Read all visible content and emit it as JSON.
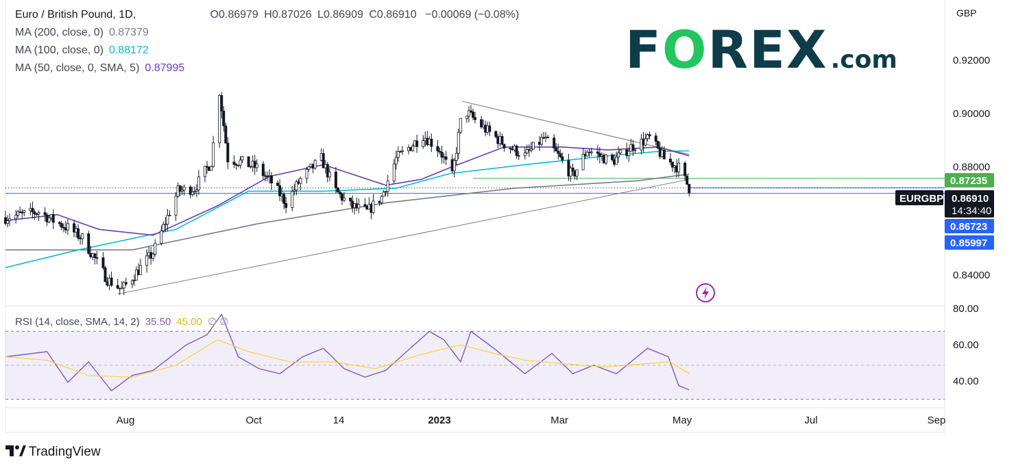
{
  "header": {
    "symbol": "Euro / British Pound, 1D,",
    "open": "O0.86979",
    "high": "H0.87026",
    "low": "L0.86909",
    "close": "C0.86910",
    "change": "−0.00069 (−0.08%)"
  },
  "indicators": {
    "ma200": {
      "label": "MA (200, close, 0)",
      "value": "0.87379",
      "color": "#787b86"
    },
    "ma100": {
      "label": "MA (100, close, 0)",
      "value": "0.88172",
      "color": "#00bcd4"
    },
    "ma50": {
      "label": "MA (50, close, 0, SMA, 5)",
      "value": "0.87995",
      "color": "#673ab7"
    },
    "rsi": {
      "label": "RSI (14, close, SMA, 14, 2)",
      "value": "35.50",
      "ma_value": "45.00",
      "extra": "∅  ∅",
      "color": "#7e57c2",
      "ma_color": "#f7d33b"
    }
  },
  "logo": {
    "text": "FOREX",
    "suffix": ".com",
    "color": "#0e3c4a",
    "accent": "#22c55e"
  },
  "footer": {
    "brand": "TradingView"
  },
  "price_axis": {
    "currency": "GBP",
    "ticks": [
      "0.92000",
      "0.90000",
      "0.88000",
      "0.84000"
    ],
    "labels": {
      "green_level": "0.87235",
      "symbol_tag": "EURGBP",
      "last_price": "0.86910",
      "countdown": "14:34:40",
      "blue_level_1": "0.86723",
      "blue_level_2": "0.85997"
    }
  },
  "rsi_axis": {
    "ticks": [
      "80.00",
      "60.00",
      "40.00"
    ]
  },
  "time_axis": {
    "labels": [
      "Aug",
      "Oct",
      "14",
      "2023",
      "Mar",
      "May",
      "Jul",
      "Sep"
    ]
  },
  "chart_data": [
    {
      "type": "candlestick",
      "title": "Euro / British Pound, 1D",
      "ylabel": "GBP",
      "ylim": [
        0.829,
        0.933
      ],
      "x_range": [
        "2022-06-15",
        "2023-09-10"
      ],
      "hlines": [
        {
          "value": 0.87235,
          "color": "#4caf50"
        },
        {
          "value": 0.86723,
          "color": "#2962ff"
        },
        {
          "value": 0.8691,
          "color": "#2962ff"
        }
      ],
      "trendlines": [
        {
          "from": [
            "2022-08-08",
            0.833
          ],
          "to": [
            "2023-05-10",
            0.872
          ]
        },
        {
          "from": [
            "2023-01-21",
            0.8985
          ],
          "to": [
            "2023-05-10",
            0.8805
          ]
        }
      ],
      "key_points": [
        {
          "date": "2022-06-15",
          "close": 0.859
        },
        {
          "date": "2022-07-01",
          "close": 0.861
        },
        {
          "date": "2022-07-08",
          "close": 0.858
        },
        {
          "date": "2022-07-15",
          "close": 0.8555
        },
        {
          "date": "2022-07-22",
          "close": 0.852
        },
        {
          "date": "2022-08-03",
          "close": 0.838
        },
        {
          "date": "2022-08-10",
          "close": 0.8345
        },
        {
          "date": "2022-08-25",
          "close": 0.847
        },
        {
          "date": "2022-09-06",
          "close": 0.868
        },
        {
          "date": "2022-09-14",
          "close": 0.869
        },
        {
          "date": "2022-09-22",
          "close": 0.878
        },
        {
          "date": "2022-09-26",
          "close": 0.902
        },
        {
          "date": "2022-09-30",
          "close": 0.879
        },
        {
          "date": "2022-10-06",
          "close": 0.878
        },
        {
          "date": "2022-10-14",
          "close": 0.876
        },
        {
          "date": "2022-10-21",
          "close": 0.871
        },
        {
          "date": "2022-10-28",
          "close": 0.864
        },
        {
          "date": "2022-11-04",
          "close": 0.872
        },
        {
          "date": "2022-11-14",
          "close": 0.879
        },
        {
          "date": "2022-11-21",
          "close": 0.868
        },
        {
          "date": "2022-11-28",
          "close": 0.863
        },
        {
          "date": "2022-12-06",
          "close": 0.861
        },
        {
          "date": "2022-12-13",
          "close": 0.866
        },
        {
          "date": "2022-12-20",
          "close": 0.879
        },
        {
          "date": "2023-01-02",
          "close": 0.887
        },
        {
          "date": "2023-01-10",
          "close": 0.882
        },
        {
          "date": "2023-01-16",
          "close": 0.873
        },
        {
          "date": "2023-01-21",
          "close": 0.896
        },
        {
          "date": "2023-02-01",
          "close": 0.889
        },
        {
          "date": "2023-02-10",
          "close": 0.884
        },
        {
          "date": "2023-02-20",
          "close": 0.88
        },
        {
          "date": "2023-03-01",
          "close": 0.886
        },
        {
          "date": "2023-03-08",
          "close": 0.88
        },
        {
          "date": "2023-03-15",
          "close": 0.873
        },
        {
          "date": "2023-03-22",
          "close": 0.882
        },
        {
          "date": "2023-04-03",
          "close": 0.878
        },
        {
          "date": "2023-04-12",
          "close": 0.883
        },
        {
          "date": "2023-04-21",
          "close": 0.886
        },
        {
          "date": "2023-04-28",
          "close": 0.879
        },
        {
          "date": "2023-05-05",
          "close": 0.876
        },
        {
          "date": "2023-05-10",
          "close": 0.8691
        }
      ],
      "series": [
        {
          "name": "MA (200, close, 0)",
          "color": "#787b86",
          "points": [
            [
              "2022-06-15",
              0.848
            ],
            [
              "2022-08-15",
              0.848
            ],
            [
              "2022-10-15",
              0.857
            ],
            [
              "2022-12-15",
              0.864
            ],
            [
              "2023-02-15",
              0.869
            ],
            [
              "2023-04-15",
              0.8715
            ],
            [
              "2023-05-10",
              0.8738
            ]
          ]
        },
        {
          "name": "MA (100, close, 0)",
          "color": "#00bcd4",
          "points": [
            [
              "2022-06-15",
              0.842
            ],
            [
              "2022-07-20",
              0.848
            ],
            [
              "2022-09-05",
              0.855
            ],
            [
              "2022-10-10",
              0.868
            ],
            [
              "2022-11-15",
              0.868
            ],
            [
              "2022-12-20",
              0.869
            ],
            [
              "2023-01-15",
              0.874
            ],
            [
              "2023-02-20",
              0.877
            ],
            [
              "2023-04-01",
              0.88
            ],
            [
              "2023-04-25",
              0.8815
            ],
            [
              "2023-05-10",
              0.8817
            ]
          ]
        },
        {
          "name": "MA (50, close, 0, SMA, 5)",
          "color": "#673ab7",
          "points": [
            [
              "2022-06-15",
              0.858
            ],
            [
              "2022-07-10",
              0.86
            ],
            [
              "2022-07-30",
              0.855
            ],
            [
              "2022-08-25",
              0.853
            ],
            [
              "2022-09-25",
              0.863
            ],
            [
              "2022-10-20",
              0.873
            ],
            [
              "2022-11-15",
              0.877
            ],
            [
              "2022-12-15",
              0.87
            ],
            [
              "2023-01-01",
              0.872
            ],
            [
              "2023-01-15",
              0.876
            ],
            [
              "2023-02-10",
              0.883
            ],
            [
              "2023-03-10",
              0.883
            ],
            [
              "2023-04-01",
              0.882
            ],
            [
              "2023-04-25",
              0.883
            ],
            [
              "2023-05-10",
              0.88
            ]
          ]
        }
      ]
    },
    {
      "type": "line",
      "title": "RSI (14, close, SMA, 14, 2)",
      "ylim": [
        25,
        85
      ],
      "bands": [
        30,
        50,
        70
      ],
      "series": [
        {
          "name": "RSI",
          "color": "#7e57c2",
          "points": [
            [
              "2022-06-15",
              55
            ],
            [
              "2022-07-05",
              58
            ],
            [
              "2022-07-15",
              40
            ],
            [
              "2022-07-25",
              52
            ],
            [
              "2022-08-05",
              35
            ],
            [
              "2022-08-15",
              44
            ],
            [
              "2022-08-25",
              47
            ],
            [
              "2022-09-10",
              62
            ],
            [
              "2022-09-20",
              68
            ],
            [
              "2022-09-27",
              80
            ],
            [
              "2022-10-05",
              55
            ],
            [
              "2022-10-15",
              48
            ],
            [
              "2022-10-25",
              45
            ],
            [
              "2022-11-05",
              55
            ],
            [
              "2022-11-15",
              60
            ],
            [
              "2022-11-25",
              48
            ],
            [
              "2022-12-05",
              43
            ],
            [
              "2022-12-15",
              47
            ],
            [
              "2022-12-25",
              58
            ],
            [
              "2023-01-05",
              70
            ],
            [
              "2023-01-12",
              65
            ],
            [
              "2023-01-20",
              52
            ],
            [
              "2023-01-25",
              70
            ],
            [
              "2023-02-05",
              60
            ],
            [
              "2023-02-20",
              45
            ],
            [
              "2023-03-05",
              57
            ],
            [
              "2023-03-15",
              45
            ],
            [
              "2023-03-25",
              50
            ],
            [
              "2023-04-05",
              45
            ],
            [
              "2023-04-20",
              60
            ],
            [
              "2023-04-30",
              55
            ],
            [
              "2023-05-05",
              38
            ],
            [
              "2023-05-10",
              35.5
            ]
          ]
        },
        {
          "name": "RSI SMA",
          "color": "#f7d33b",
          "points": [
            [
              "2022-06-15",
              55
            ],
            [
              "2022-07-05",
              53
            ],
            [
              "2022-07-25",
              44
            ],
            [
              "2022-08-15",
              43
            ],
            [
              "2022-09-05",
              50
            ],
            [
              "2022-09-25",
              65
            ],
            [
              "2022-10-10",
              58
            ],
            [
              "2022-10-30",
              52
            ],
            [
              "2022-11-20",
              52
            ],
            [
              "2022-12-10",
              48
            ],
            [
              "2022-12-31",
              56
            ],
            [
              "2023-01-20",
              62
            ],
            [
              "2023-02-05",
              57
            ],
            [
              "2023-02-20",
              53
            ],
            [
              "2023-03-10",
              51
            ],
            [
              "2023-03-30",
              49
            ],
            [
              "2023-04-20",
              51
            ],
            [
              "2023-05-01",
              52
            ],
            [
              "2023-05-10",
              45
            ]
          ]
        }
      ]
    }
  ]
}
